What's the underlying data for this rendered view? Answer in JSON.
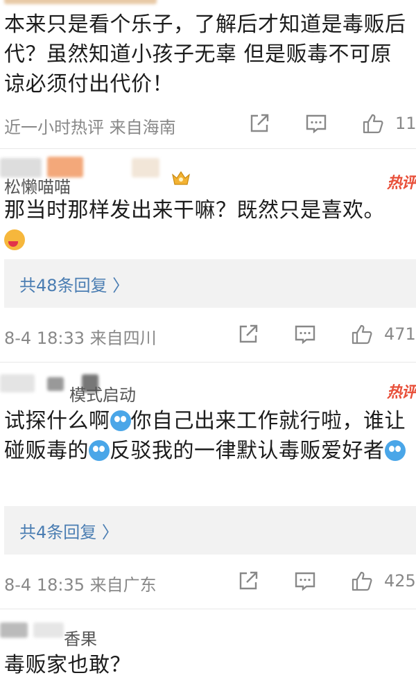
{
  "comments": [
    {
      "text": "本来只是看个乐子，了解后才知道是毒贩后代？虽然知道小孩子无辜 但是贩毒不可原谅必须付出代价！",
      "meta": "近一小时热评  来自海南",
      "likes": "11"
    },
    {
      "username": "松懒喵喵",
      "hot_label": "热评",
      "text": "那当时那样发出来干嘛？既然只是喜欢。",
      "reply_link": "共48条回复 〉",
      "meta": "8-4 18:33  来自四川",
      "likes": "471"
    },
    {
      "username": "模式启动",
      "hot_label": "热评",
      "text_part1": "试探什么啊",
      "text_part2": "你自己出来工作就行啦，谁让碰贩毒的",
      "text_part3": "反驳我的一律默认毒贩爱好者",
      "reply_link": "共4条回复 〉",
      "meta": "8-4 18:35  来自广东",
      "likes": "425"
    },
    {
      "username": "香果",
      "text": "毒贩家也敢？"
    }
  ],
  "colors": {
    "hot": "#e8503a",
    "link": "#4a7db2",
    "meta": "#888888",
    "reply_bg": "#f2f2f2"
  },
  "icons": [
    "share-icon",
    "comment-icon",
    "like-icon",
    "crown-icon",
    "laugh-cry-emoji",
    "drool-emoji"
  ]
}
